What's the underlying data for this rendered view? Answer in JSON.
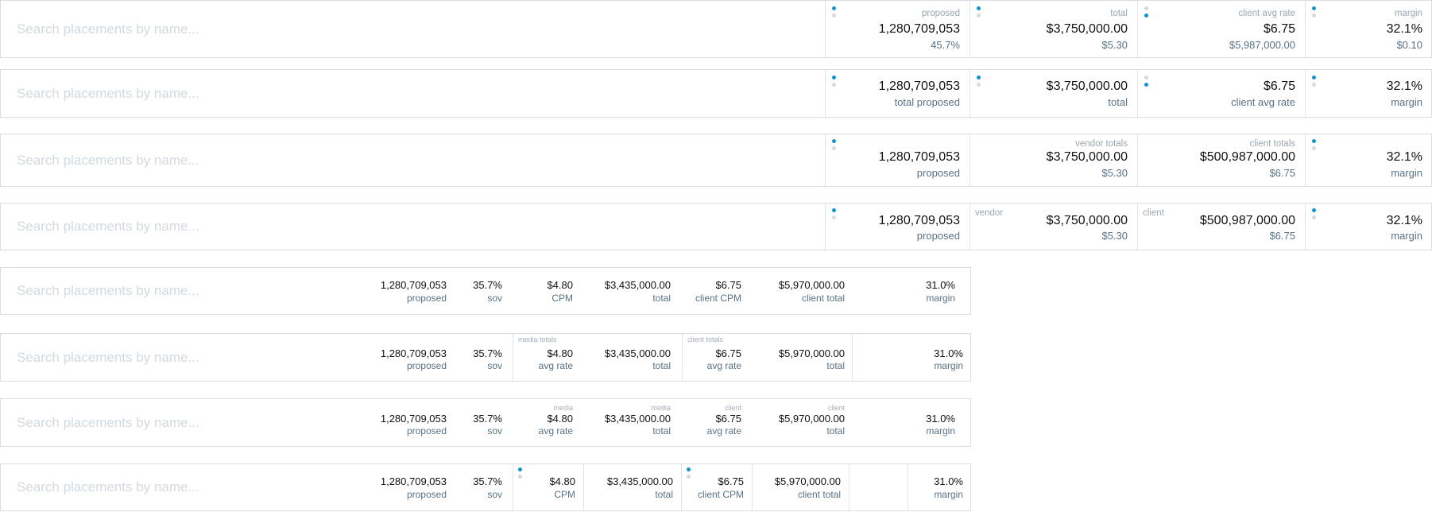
{
  "search_placeholder": "Search placements by name...",
  "colors": {
    "accent_dot": "#1192d6",
    "inactive_dot": "#d3d9de",
    "label": "#5a7285"
  },
  "v1": {
    "proposed": {
      "caption": "proposed",
      "value": "1,280,709,053",
      "sub": "45.7%"
    },
    "total": {
      "caption": "total",
      "value": "$3,750,000.00",
      "sub": "$5.30"
    },
    "client_avg_rate": {
      "caption": "client avg rate",
      "value": "$6.75",
      "sub": "$5,987,000.00"
    },
    "margin": {
      "caption": "margin",
      "value": "32.1%",
      "sub": "$0.10"
    }
  },
  "v2": {
    "proposed": {
      "value": "1,280,709,053",
      "label": "total proposed"
    },
    "total": {
      "value": "$3,750,000.00",
      "label": "total"
    },
    "client_avg_rate": {
      "value": "$6.75",
      "label": "client avg rate"
    },
    "margin": {
      "value": "32.1%",
      "label": "margin"
    }
  },
  "v3": {
    "proposed": {
      "value": "1,280,709,053",
      "label": "proposed"
    },
    "vendor": {
      "caption": "vendor totals",
      "value": "$3,750,000.00",
      "sub": "$5.30"
    },
    "client": {
      "caption": "client totals",
      "value": "$500,987,000.00",
      "sub": "$6.75"
    },
    "margin": {
      "value": "32.1%",
      "label": "margin"
    }
  },
  "v4": {
    "proposed": {
      "value": "1,280,709,053",
      "label": "proposed"
    },
    "vendor": {
      "caption": "vendor",
      "value": "$3,750,000.00",
      "sub": "$5.30"
    },
    "client": {
      "caption": "client",
      "value": "$500,987,000.00",
      "sub": "$6.75"
    },
    "margin": {
      "value": "32.1%",
      "label": "margin"
    }
  },
  "v5": {
    "proposed": {
      "value": "1,280,709,053",
      "label": "proposed"
    },
    "sov": {
      "value": "35.7%",
      "label": "sov"
    },
    "cpm": {
      "value": "$4.80",
      "label": "CPM"
    },
    "total": {
      "value": "$3,435,000.00",
      "label": "total"
    },
    "client_cpm": {
      "value": "$6.75",
      "label": "client CPM"
    },
    "client_total": {
      "value": "$5,970,000.00",
      "label": "client total"
    },
    "margin": {
      "value": "31.0%",
      "label": "margin"
    }
  },
  "v6": {
    "media_caption": "media totals",
    "client_caption": "client totals",
    "proposed": {
      "value": "1,280,709,053",
      "label": "proposed"
    },
    "sov": {
      "value": "35.7%",
      "label": "sov"
    },
    "avg_rate": {
      "value": "$4.80",
      "label": "avg rate"
    },
    "total": {
      "value": "$3,435,000.00",
      "label": "total"
    },
    "client_avg_rate": {
      "value": "$6.75",
      "label": "avg rate"
    },
    "client_total": {
      "value": "$5,970,000.00",
      "label": "total"
    },
    "margin": {
      "value": "31.0%",
      "label": "margin"
    }
  },
  "v7": {
    "media_caption": "media",
    "client_caption": "client",
    "proposed": {
      "value": "1,280,709,053",
      "label": "proposed"
    },
    "sov": {
      "value": "35.7%",
      "label": "sov"
    },
    "avg_rate": {
      "value": "$4.80",
      "label": "avg rate"
    },
    "total": {
      "value": "$3,435,000.00",
      "label": "total"
    },
    "client_avg_rate": {
      "value": "$6.75",
      "label": "avg rate"
    },
    "client_total": {
      "value": "$5,970,000.00",
      "label": "total"
    },
    "margin": {
      "value": "31.0%",
      "label": "margin"
    }
  },
  "v8": {
    "proposed": {
      "value": "1,280,709,053",
      "label": "proposed"
    },
    "sov": {
      "value": "35.7%",
      "label": "sov"
    },
    "cpm": {
      "value": "$4.80",
      "label": "CPM"
    },
    "total": {
      "value": "$3,435,000.00",
      "label": "total"
    },
    "client_cpm": {
      "value": "$6.75",
      "label": "client CPM"
    },
    "client_total": {
      "value": "$5,970,000.00",
      "label": "client total"
    },
    "margin": {
      "value": "31.0%",
      "label": "margin"
    }
  }
}
